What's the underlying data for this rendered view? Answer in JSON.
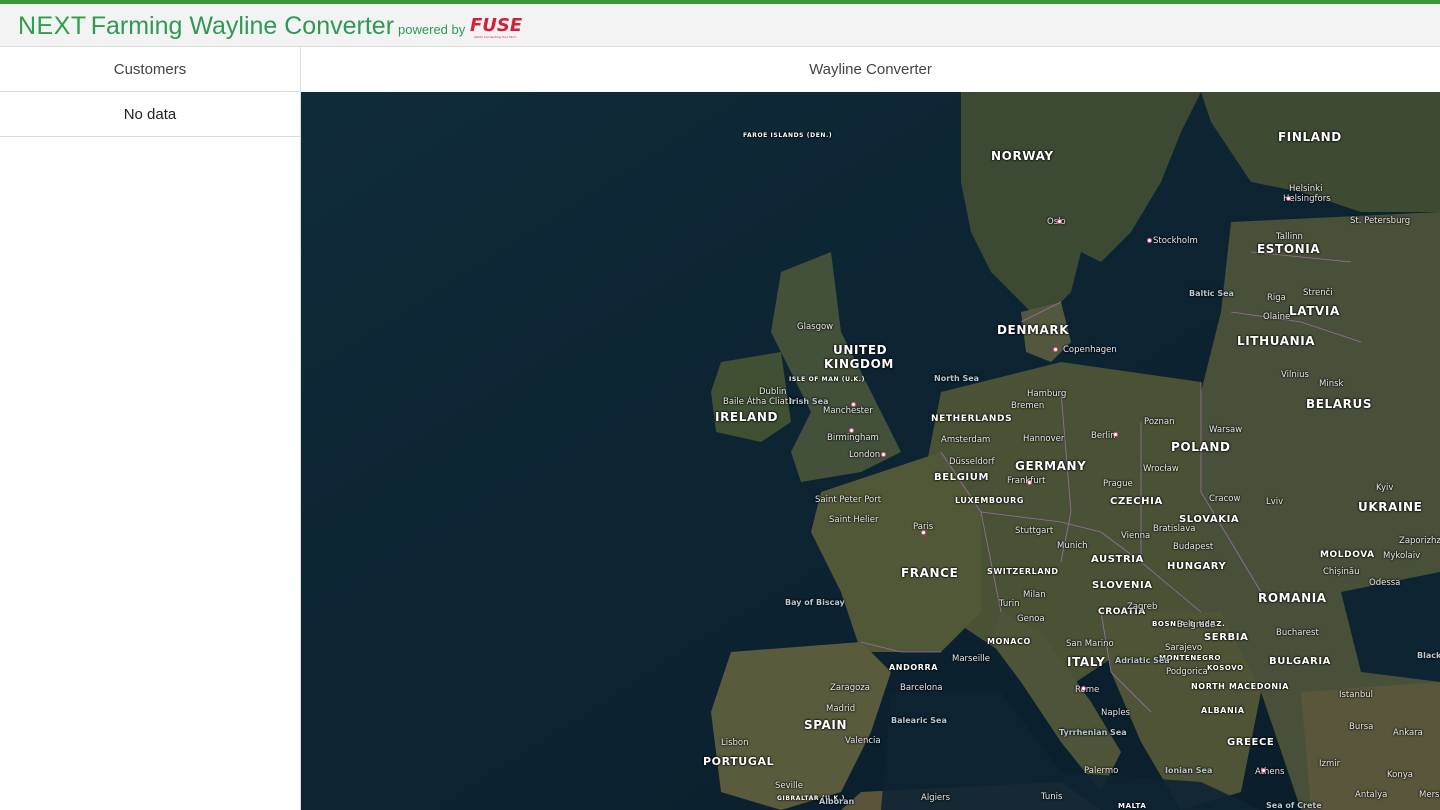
{
  "header": {
    "brand_next": "NEXT",
    "title": "Farming Wayline Converter",
    "powered_by": "powered by",
    "logo_text": "FUSE",
    "logo_tagline": "AGCO Connecting Your Farm",
    "accent_color": "#3a9a3a",
    "logo_color": "#d0223a"
  },
  "sidebar": {
    "title": "Customers",
    "empty_text": "No data"
  },
  "main": {
    "title": "Wayline Converter"
  },
  "map": {
    "countries": [
      "FINLAND",
      "NORWAY",
      "ESTONIA",
      "LATVIA",
      "DENMARK",
      "LITHUANIA",
      "UNITED",
      "KINGDOM",
      "BELARUS",
      "IRELAND",
      "NETHERLANDS",
      "POLAND",
      "GERMANY",
      "BELGIUM",
      "CZECHIA",
      "UKRAINE",
      "SLOVAKIA",
      "LUXEMBOURG",
      "MOLDOVA",
      "FRANCE",
      "AUSTRIA",
      "HUNGARY",
      "SLOVENIA",
      "SWITZERLAND",
      "ROMANIA",
      "CROATIA",
      "BOSNIA & HERZ.",
      "SERBIA",
      "MONACO",
      "ITALY",
      "MONTENEGRO",
      "BULGARIA",
      "KOSOVO",
      "ANDORRA",
      "NORTH MACEDONIA",
      "ALBANIA",
      "SPAIN",
      "GREECE",
      "PORTUGAL",
      "FAROE ISLANDS (DEN.)",
      "ISLE OF MAN (U.K.)",
      "GIBRALTAR (U.K.)",
      "MALTA"
    ],
    "cities": [
      "Helsinki",
      "Helsingfors",
      "St. Petersburg",
      "Tallinn",
      "Oslo",
      "Stockholm",
      "Riga",
      "Strenči",
      "Olaine",
      "Copenhagen",
      "Glasgow",
      "Dublin",
      "Baile Átha Cliath",
      "Manchester",
      "Birmingham",
      "London",
      "Hamburg",
      "Bremen",
      "Amsterdam",
      "Hannover",
      "Berlin",
      "Poznan",
      "Warsaw",
      "Vilnius",
      "Minsk",
      "Düsseldorf",
      "Frankfurt",
      "Wrocław",
      "Prague",
      "Cracow",
      "Kyiv",
      "Lviv",
      "Saint Peter Port",
      "Saint Helier",
      "Paris",
      "Stuttgart",
      "Munich",
      "Vienna",
      "Bratislava",
      "Budapest",
      "Zaporizhz",
      "Chișinău",
      "Mykolaiv",
      "Odessa",
      "Milan",
      "Turin",
      "Genoa",
      "Zagreb",
      "Belgrade",
      "Sarajevo",
      "Bucharest",
      "Marseille",
      "San Marino",
      "Podgorica",
      "Zaragoza",
      "Barcelona",
      "Rome",
      "Istanbul",
      "Bursa",
      "Ankara",
      "Madrid",
      "Naples",
      "Valencia",
      "Lisbon",
      "Seville",
      "Algiers",
      "Tunis",
      "Athens",
      "Izmir",
      "Konya",
      "Antalya",
      "Mersi"
    ],
    "seas": [
      "Baltic Sea",
      "North Sea",
      "Irish Sea",
      "Bay of Biscay",
      "Adriatic Sea",
      "Balearic Sea",
      "Tyrrhenian Sea",
      "Ionian Sea",
      "Black",
      "Alboran",
      "Palermo",
      "Sea of Crete"
    ]
  }
}
